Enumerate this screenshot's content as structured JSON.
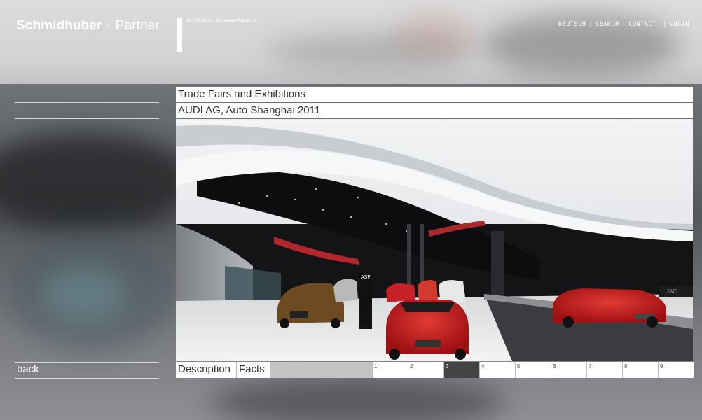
{
  "header": {
    "logo_bold": "Schmidhuber",
    "logo_plus": "+",
    "logo_rest": "Partner",
    "subnav": [
      "Architektur",
      "Innenarchitektur"
    ],
    "topnav": [
      "DEUTSCH",
      "SEARCH",
      "CONTACT",
      "LOGIN"
    ]
  },
  "sidebar": {
    "back_label": "back"
  },
  "main": {
    "category": "Trade Fairs and Exhibitions",
    "project": "AUDI AG, Auto Shanghai 2011"
  },
  "tabs": {
    "description": "Description",
    "facts": "Facts"
  },
  "pagination": {
    "pages": [
      "1",
      "2",
      "3",
      "4",
      "5",
      "6",
      "7",
      "8",
      "9"
    ],
    "active": "3"
  },
  "photo": {
    "sign_text": "ASF",
    "right_sign_text": "JAC"
  },
  "colors": {
    "accent_red": "#c8171c",
    "ceiling": "#eceef0",
    "active_page": "#444444"
  }
}
